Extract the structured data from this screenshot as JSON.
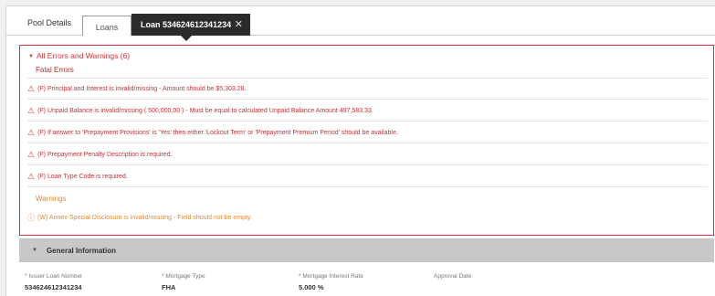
{
  "tabs": {
    "pool_details": "Pool Details",
    "loans": "Loans",
    "loan": "Loan 534624612341234",
    "close_glyph": "✕"
  },
  "errors": {
    "header": "All Errors and Warnings (6)",
    "caret": "▼",
    "fatal_title": "Fatal Errors",
    "fatal": [
      "(F) Principal and Interest is invalid/missing - Amount should be $5,303.28.",
      "(F) Unpaid Balance is invalid/missing ( 500,000.00 ) - Must be equal to calculated Unpaid Balance Amount 497,583.33.",
      "(F) If answer to 'Prepayment Provisions' is 'Yes' then either 'Lockout Term' or 'Prepayment Premium Period' should be available.",
      "(F) Prepayment Penalty Description is required.",
      "(F) Loan Type Code is required."
    ],
    "warnings_title": "Warnings",
    "warnings": [
      "(W) Annex-Special Disclosure is invalid/missing - Field should not be empty."
    ],
    "fatal_icon": "warning-triangle-icon",
    "warning_icon": "info-circle-icon",
    "color_fatal": "#cc2f36",
    "color_warning": "#e38a31"
  },
  "general": {
    "title": "General Information",
    "caret": "▼",
    "fields": [
      {
        "label": "* Issuer Loan Number",
        "value": "534624612341234"
      },
      {
        "label": "* Mortgage Type",
        "value": "FHA"
      },
      {
        "label": "* Mortgage Interest Rate",
        "value": "5.000 %"
      },
      {
        "label": "Approval Date",
        "value": ""
      }
    ]
  }
}
